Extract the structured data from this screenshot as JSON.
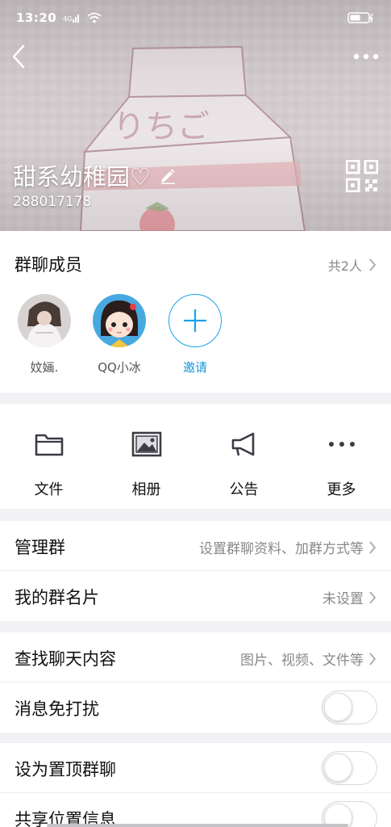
{
  "statusbar": {
    "time": "13:20"
  },
  "header": {
    "group_name": "甜系幼稚园♡",
    "group_id": "288017178"
  },
  "members": {
    "title": "群聊成员",
    "count_label": "共2人",
    "list": [
      {
        "name": "妏婳."
      },
      {
        "name": "QQ小冰"
      }
    ],
    "invite_label": "邀请"
  },
  "actions": [
    {
      "label": "文件",
      "icon": "folder-icon"
    },
    {
      "label": "相册",
      "icon": "album-icon"
    },
    {
      "label": "公告",
      "icon": "megaphone-icon"
    },
    {
      "label": "更多",
      "icon": "more-dots-icon"
    }
  ],
  "settings": {
    "manage": {
      "title": "管理群",
      "value": "设置群聊资料、加群方式等"
    },
    "card": {
      "title": "我的群名片",
      "value": "未设置"
    },
    "search": {
      "title": "查找聊天内容",
      "value": "图片、视频、文件等"
    },
    "dnd": {
      "title": "消息免打扰"
    },
    "pin": {
      "title": "设为置顶群聊"
    },
    "location": {
      "title": "共享位置信息"
    }
  },
  "colors": {
    "accent": "#1aa3e8",
    "background": "#f2f2f4"
  }
}
